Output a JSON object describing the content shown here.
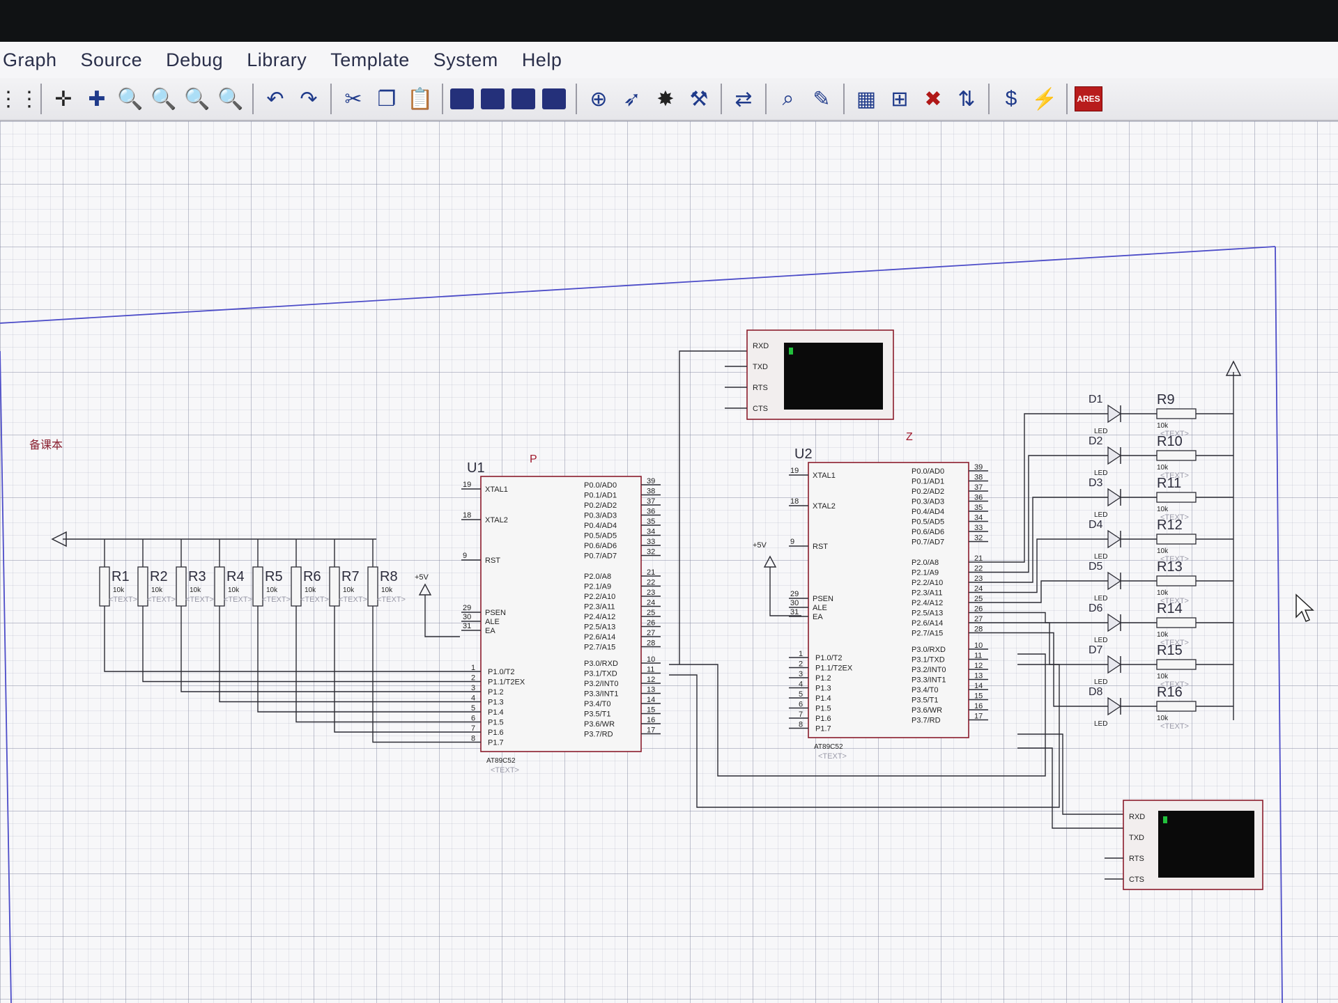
{
  "menu": [
    "Graph",
    "Source",
    "Debug",
    "Library",
    "Template",
    "System",
    "Help"
  ],
  "toolbar": {
    "left_icons": [
      "grid-icon",
      "origin-icon",
      "pan-icon",
      "zoom-in-icon",
      "zoom-out-icon",
      "zoom-all-icon",
      "zoom-area-icon"
    ],
    "edit_icons": [
      "undo-icon",
      "redo-icon",
      "cut-icon",
      "copy-icon",
      "paste-icon"
    ],
    "block_icons": [
      "block-copy-icon",
      "block-move-icon",
      "block-rotate-icon",
      "block-delete-icon"
    ],
    "tool_icons": [
      "pick-device-icon",
      "make-device-icon",
      "package-icon",
      "decompose-icon"
    ],
    "right_icons": [
      "wire-autorouter-icon",
      "search-icon",
      "property-tool-icon",
      "netlist-icon",
      "new-sheet-icon",
      "remove-sheet-icon",
      "goto-sheet-icon",
      "bill-of-materials-icon",
      "electrical-check-icon"
    ],
    "ares_label": "ARES"
  },
  "schematic": {
    "left_note": "备课本",
    "marker_u1": "P",
    "marker_u2": "Z",
    "u1": {
      "ref": "U1",
      "part": "AT89C52",
      "text": "<TEXT>",
      "left_pins": [
        {
          "num": "19",
          "name": "XTAL1"
        },
        {
          "num": "18",
          "name": "XTAL2"
        },
        {
          "num": "9",
          "name": "RST"
        },
        {
          "num": "29",
          "name": "PSEN"
        },
        {
          "num": "30",
          "name": "ALE"
        },
        {
          "num": "31",
          "name": "EA"
        }
      ],
      "p1_pins": [
        {
          "num": "1",
          "name": "P1.0/T2"
        },
        {
          "num": "2",
          "name": "P1.1/T2EX"
        },
        {
          "num": "3",
          "name": "P1.2"
        },
        {
          "num": "4",
          "name": "P1.3"
        },
        {
          "num": "5",
          "name": "P1.4"
        },
        {
          "num": "6",
          "name": "P1.5"
        },
        {
          "num": "7",
          "name": "P1.6"
        },
        {
          "num": "8",
          "name": "P1.7"
        }
      ],
      "p0_pins": [
        {
          "num": "39",
          "name": "P0.0/AD0"
        },
        {
          "num": "38",
          "name": "P0.1/AD1"
        },
        {
          "num": "37",
          "name": "P0.2/AD2"
        },
        {
          "num": "36",
          "name": "P0.3/AD3"
        },
        {
          "num": "35",
          "name": "P0.4/AD4"
        },
        {
          "num": "34",
          "name": "P0.5/AD5"
        },
        {
          "num": "33",
          "name": "P0.6/AD6"
        },
        {
          "num": "32",
          "name": "P0.7/AD7"
        }
      ],
      "p2_pins": [
        {
          "num": "21",
          "name": "P2.0/A8"
        },
        {
          "num": "22",
          "name": "P2.1/A9"
        },
        {
          "num": "23",
          "name": "P2.2/A10"
        },
        {
          "num": "24",
          "name": "P2.3/A11"
        },
        {
          "num": "25",
          "name": "P2.4/A12"
        },
        {
          "num": "26",
          "name": "P2.5/A13"
        },
        {
          "num": "27",
          "name": "P2.6/A14"
        },
        {
          "num": "28",
          "name": "P2.7/A15"
        }
      ],
      "p3_pins": [
        {
          "num": "10",
          "name": "P3.0/RXD"
        },
        {
          "num": "11",
          "name": "P3.1/TXD"
        },
        {
          "num": "12",
          "name": "P3.2/INT0"
        },
        {
          "num": "13",
          "name": "P3.3/INT1"
        },
        {
          "num": "14",
          "name": "P3.4/T0"
        },
        {
          "num": "15",
          "name": "P3.5/T1"
        },
        {
          "num": "16",
          "name": "P3.6/WR"
        },
        {
          "num": "17",
          "name": "P3.7/RD"
        }
      ]
    },
    "u2": {
      "ref": "U2",
      "part": "AT89C52",
      "text": "<TEXT>",
      "left_pins": [
        {
          "num": "19",
          "name": "XTAL1"
        },
        {
          "num": "18",
          "name": "XTAL2"
        },
        {
          "num": "9",
          "name": "RST"
        },
        {
          "num": "29",
          "name": "PSEN"
        },
        {
          "num": "30",
          "name": "ALE"
        },
        {
          "num": "31",
          "name": "EA"
        }
      ],
      "p1_pins": [
        {
          "num": "1",
          "name": "P1.0/T2"
        },
        {
          "num": "2",
          "name": "P1.1/T2EX"
        },
        {
          "num": "3",
          "name": "P1.2"
        },
        {
          "num": "4",
          "name": "P1.3"
        },
        {
          "num": "5",
          "name": "P1.4"
        },
        {
          "num": "6",
          "name": "P1.5"
        },
        {
          "num": "7",
          "name": "P1.6"
        },
        {
          "num": "8",
          "name": "P1.7"
        }
      ],
      "p0_pins": [
        {
          "num": "39",
          "name": "P0.0/AD0"
        },
        {
          "num": "38",
          "name": "P0.1/AD1"
        },
        {
          "num": "37",
          "name": "P0.2/AD2"
        },
        {
          "num": "36",
          "name": "P0.3/AD3"
        },
        {
          "num": "35",
          "name": "P0.4/AD4"
        },
        {
          "num": "34",
          "name": "P0.5/AD5"
        },
        {
          "num": "33",
          "name": "P0.6/AD6"
        },
        {
          "num": "32",
          "name": "P0.7/AD7"
        }
      ],
      "p2_pins": [
        {
          "num": "21",
          "name": "P2.0/A8"
        },
        {
          "num": "22",
          "name": "P2.1/A9"
        },
        {
          "num": "23",
          "name": "P2.2/A10"
        },
        {
          "num": "24",
          "name": "P2.3/A11"
        },
        {
          "num": "25",
          "name": "P2.4/A12"
        },
        {
          "num": "26",
          "name": "P2.5/A13"
        },
        {
          "num": "27",
          "name": "P2.6/A14"
        },
        {
          "num": "28",
          "name": "P2.7/A15"
        }
      ],
      "p3_pins": [
        {
          "num": "10",
          "name": "P3.0/RXD"
        },
        {
          "num": "11",
          "name": "P3.1/TXD"
        },
        {
          "num": "12",
          "name": "P3.2/INT0"
        },
        {
          "num": "13",
          "name": "P3.3/INT1"
        },
        {
          "num": "14",
          "name": "P3.4/T0"
        },
        {
          "num": "15",
          "name": "P3.5/T1"
        },
        {
          "num": "16",
          "name": "P3.6/WR"
        },
        {
          "num": "17",
          "name": "P3.7/RD"
        }
      ]
    },
    "resistor_bank": [
      {
        "ref": "R1",
        "value": "10k"
      },
      {
        "ref": "R2",
        "value": "10k"
      },
      {
        "ref": "R3",
        "value": "10k"
      },
      {
        "ref": "R4",
        "value": "10k"
      },
      {
        "ref": "R5",
        "value": "10k"
      },
      {
        "ref": "R6",
        "value": "10k"
      },
      {
        "ref": "R7",
        "value": "10k"
      },
      {
        "ref": "R8",
        "value": "10k"
      }
    ],
    "supply_label": "+5V",
    "leds": [
      {
        "ref": "D1",
        "part": "LED"
      },
      {
        "ref": "D2",
        "part": "LED"
      },
      {
        "ref": "D3",
        "part": "LED"
      },
      {
        "ref": "D4",
        "part": "LED"
      },
      {
        "ref": "D5",
        "part": "LED"
      },
      {
        "ref": "D6",
        "part": "LED"
      },
      {
        "ref": "D7",
        "part": "LED"
      },
      {
        "ref": "D8",
        "part": "LED"
      }
    ],
    "led_resistors": [
      {
        "ref": "R9",
        "value": "10k"
      },
      {
        "ref": "R10",
        "value": "10k"
      },
      {
        "ref": "R11",
        "value": "10k"
      },
      {
        "ref": "R12",
        "value": "10k"
      },
      {
        "ref": "R13",
        "value": "10k"
      },
      {
        "ref": "R14",
        "value": "10k"
      },
      {
        "ref": "R15",
        "value": "10k"
      },
      {
        "ref": "R16",
        "value": "10k"
      }
    ],
    "text_placeholder": "<TEXT>",
    "terminal_pins": [
      "RXD",
      "TXD",
      "RTS",
      "CTS"
    ]
  }
}
